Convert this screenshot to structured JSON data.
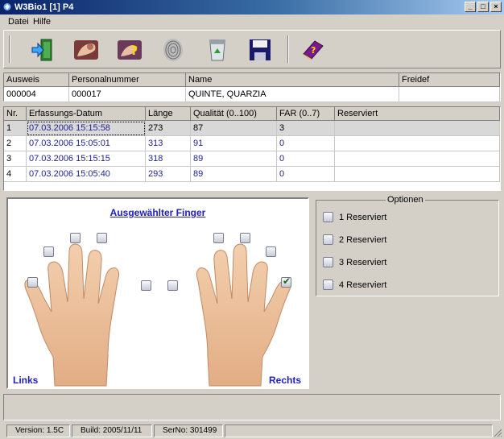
{
  "window": {
    "title": "W3Bio1 [1] P4",
    "min": "_",
    "max": "□",
    "close": "×"
  },
  "menu": {
    "items": [
      "Datei",
      "Hilfe"
    ]
  },
  "toolbar": {
    "icons": [
      "exit-door-icon",
      "fingerprint-hand-icon",
      "help-hand-icon",
      "fingerprint-pattern-icon",
      "recycle-bin-icon",
      "save-disk-icon",
      "help-book-icon"
    ]
  },
  "person": {
    "headers": [
      "Ausweis",
      "Personalnummer",
      "Name",
      "Freidef"
    ],
    "row": [
      "000004",
      "000017",
      "QUINTE, QUARZIA",
      ""
    ]
  },
  "captures": {
    "headers": [
      "Nr.",
      "Erfassungs-Datum",
      "Länge",
      "Qualität (0..100)",
      "FAR (0..7)",
      "Reserviert"
    ],
    "rows": [
      [
        "1",
        "07.03.2006 15:15:58",
        "273",
        "87",
        "3",
        ""
      ],
      [
        "2",
        "07.03.2006 15:05:01",
        "313",
        "91",
        "0",
        ""
      ],
      [
        "3",
        "07.03.2006 15:15:15",
        "318",
        "89",
        "0",
        ""
      ],
      [
        "4",
        "07.03.2006 15:05:40",
        "293",
        "89",
        "0",
        ""
      ]
    ]
  },
  "finger_panel": {
    "title": "Ausgewählter Finger",
    "left_label": "Links",
    "right_label": "Rechts",
    "fingers_checked": [
      false,
      false,
      false,
      false,
      false,
      false,
      false,
      false,
      false,
      true
    ]
  },
  "options": {
    "title": "Optionen",
    "items": [
      {
        "label": "1 Reserviert",
        "checked": false
      },
      {
        "label": "2 Reserviert",
        "checked": false
      },
      {
        "label": "3 Reserviert",
        "checked": false
      },
      {
        "label": "4 Reserviert",
        "checked": false
      }
    ]
  },
  "status": {
    "version": "Version: 1.5C",
    "build": "Build: 2005/11/11",
    "serno": "SerNo: 301499"
  },
  "colors": {
    "title_start": "#0a246a",
    "title_end": "#a6caf0",
    "link_blue": "#2020c0",
    "cell_blue": "#1f1f8f",
    "skin": "#f0c6a0"
  }
}
